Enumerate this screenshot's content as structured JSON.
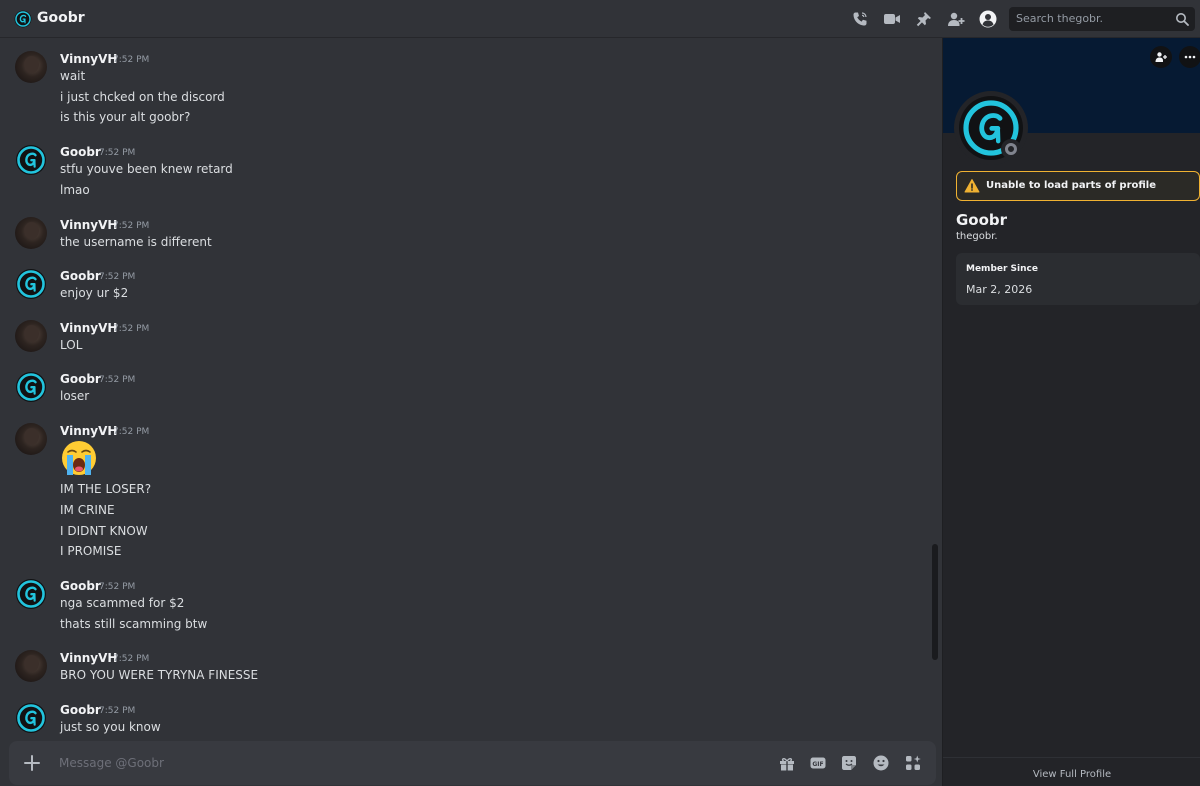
{
  "header": {
    "title": "Goobr",
    "search_placeholder": "Search thegobr."
  },
  "messages": [
    {
      "author": "VinnyVH",
      "time": "7:52 PM",
      "avatar": "vinny",
      "lines": [
        "wait",
        "i just chcked on the discord",
        "is this your alt goobr?"
      ]
    },
    {
      "author": "Goobr",
      "time": "7:52 PM",
      "avatar": "goobr",
      "lines": [
        "stfu youve been knew retard",
        "lmao"
      ]
    },
    {
      "author": "VinnyVH",
      "time": "7:52 PM",
      "avatar": "vinny",
      "lines": [
        "the username is different"
      ]
    },
    {
      "author": "Goobr",
      "time": "7:52 PM",
      "avatar": "goobr",
      "lines": [
        "enjoy ur $2"
      ]
    },
    {
      "author": "VinnyVH",
      "time": "7:52 PM",
      "avatar": "vinny",
      "lines": [
        "LOL"
      ]
    },
    {
      "author": "Goobr",
      "time": "7:52 PM",
      "avatar": "goobr",
      "lines": [
        "loser"
      ]
    },
    {
      "author": "VinnyVH",
      "time": "7:52 PM",
      "avatar": "vinny",
      "emoji": "loudly-crying-face",
      "lines": [
        "IM THE LOSER?",
        "IM CRINE",
        "I DIDNT KNOW",
        "I PROMISE"
      ]
    },
    {
      "author": "Goobr",
      "time": "7:52 PM",
      "avatar": "goobr",
      "lines": [
        "nga scammed for $2",
        "thats still scamming btw"
      ]
    },
    {
      "author": "VinnyVH",
      "time": "7:52 PM",
      "avatar": "vinny",
      "lines": [
        "BRO YOU WERE TYRYNA FINESSE"
      ]
    },
    {
      "author": "Goobr",
      "time": "7:52 PM",
      "avatar": "goobr",
      "lines": [
        "just so you know"
      ]
    }
  ],
  "composer": {
    "placeholder": "Message @Goobr"
  },
  "profile": {
    "warning": "Unable to load parts of profile",
    "display_name": "Goobr",
    "username": "thegobr.",
    "member_since_label": "Member Since",
    "member_since": "Mar 2, 2026",
    "view_full": "View Full Profile"
  },
  "colors": {
    "background": "#313338",
    "profile_banner": "#061a33",
    "accent_cyan": "#22c4dd",
    "warning": "#f0b232"
  },
  "icons": {
    "header": [
      "voice-call-icon",
      "video-call-icon",
      "pin-icon",
      "add-friends-icon",
      "user-profile-icon",
      "search-icon"
    ],
    "composer": [
      "plus-icon",
      "gift-icon",
      "gif-icon",
      "sticker-icon",
      "emoji-icon",
      "apps-icon"
    ]
  }
}
